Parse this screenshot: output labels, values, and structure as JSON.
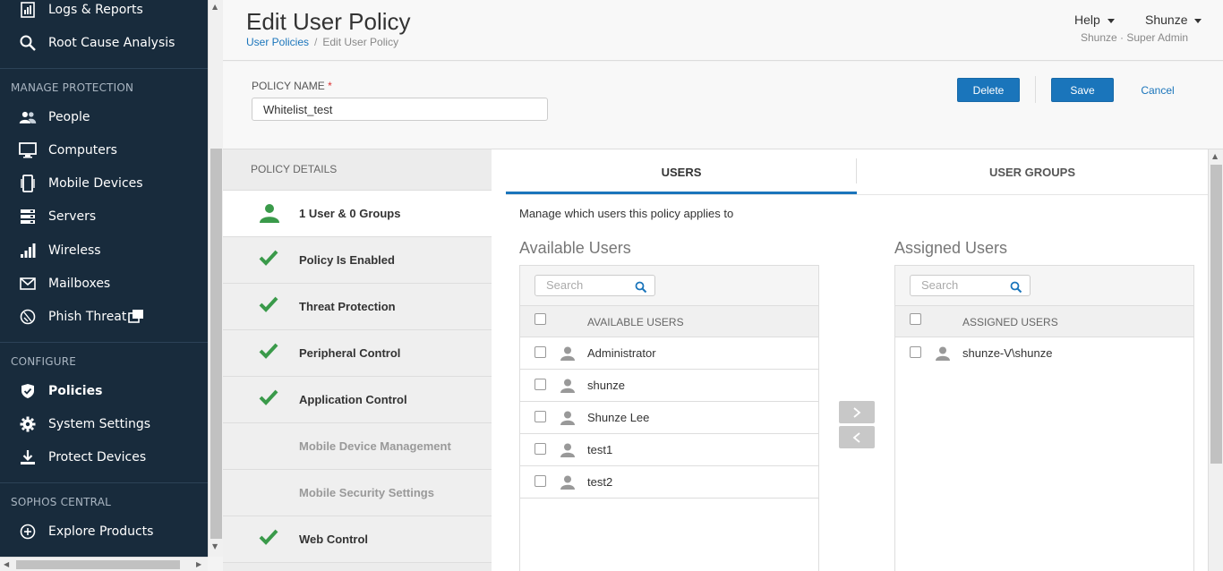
{
  "sidebar": {
    "items": [
      {
        "key": "logs",
        "label": "Logs & Reports",
        "icon": "bar-report-icon"
      },
      {
        "key": "rca",
        "label": "Root Cause Analysis",
        "icon": "magnify-icon"
      }
    ],
    "sections": [
      {
        "title": "MANAGE PROTECTION",
        "items": [
          {
            "label": "People",
            "icon": "people-icon"
          },
          {
            "label": "Computers",
            "icon": "monitor-icon"
          },
          {
            "label": "Mobile Devices",
            "icon": "mobile-icon"
          },
          {
            "label": "Servers",
            "icon": "server-icon"
          },
          {
            "label": "Wireless",
            "icon": "signal-icon"
          },
          {
            "label": "Mailboxes",
            "icon": "envelope-icon"
          },
          {
            "label": "Phish Threat",
            "icon": "phish-icon"
          }
        ]
      },
      {
        "title": "CONFIGURE",
        "items": [
          {
            "label": "Policies",
            "icon": "shield-icon"
          },
          {
            "label": "System Settings",
            "icon": "gear-icon"
          },
          {
            "label": "Protect Devices",
            "icon": "download-icon"
          }
        ]
      },
      {
        "title": "SOPHOS CENTRAL",
        "items": [
          {
            "label": "Explore Products",
            "icon": "plus-circle-icon"
          }
        ]
      }
    ]
  },
  "header": {
    "title": "Edit User Policy",
    "breadcrumb": [
      "User Policies",
      "/",
      "Edit User Policy"
    ],
    "help_label": "Help",
    "user_label": "Shunze",
    "user_role": "Shunze · Super Admin"
  },
  "policy": {
    "name_label": "POLICY NAME",
    "required_mark": "*",
    "name_value": "Whitelist_test",
    "delete_label": "Delete",
    "save_label": "Save",
    "cancel_label": "Cancel"
  },
  "details": {
    "title": "POLICY DETAILS",
    "rows": [
      {
        "label": "1 User  & 0 Groups",
        "icon": "user-icon"
      },
      {
        "label": "Policy Is Enabled",
        "icon": "check-icon"
      },
      {
        "label": "Threat Protection",
        "icon": "check-icon"
      },
      {
        "label": "Peripheral Control",
        "icon": "check-icon"
      },
      {
        "label": "Application Control",
        "icon": "check-icon"
      },
      {
        "label": "Mobile Device Management",
        "icon": ""
      },
      {
        "label": "Mobile Security Settings",
        "icon": ""
      },
      {
        "label": "Web Control",
        "icon": "check-icon"
      }
    ]
  },
  "main": {
    "tabs": [
      {
        "label": "USERS"
      },
      {
        "label": "USER GROUPS"
      }
    ],
    "manage_text": "Manage which users this policy applies to",
    "available": {
      "title": "Available Users",
      "search_placeholder": "Search",
      "header": "AVAILABLE USERS",
      "rows": [
        "Administrator",
        "shunze",
        "Shunze Lee",
        "test1",
        "test2"
      ]
    },
    "assigned": {
      "title": "Assigned Users",
      "search_placeholder": "Search",
      "header": "ASSIGNED USERS",
      "rows": [
        "shunze-V\\shunze"
      ]
    }
  },
  "colors": {
    "sidebar_bg": "#182b3c",
    "accent": "#1a75bb",
    "check": "#3a9a4a"
  }
}
